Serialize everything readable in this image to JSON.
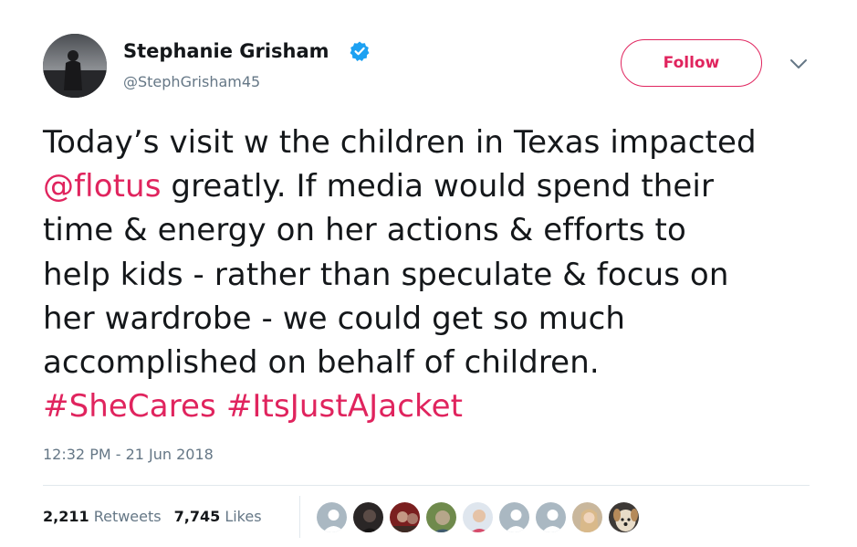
{
  "author": {
    "display_name": "Stephanie Grisham",
    "handle": "@StephGrisham45",
    "verified_icon": "verified-badge-icon",
    "avatar_icon": "profile-photo"
  },
  "follow_button": {
    "label": "Follow"
  },
  "menu": {
    "icon": "chevron-down-icon"
  },
  "tweet": {
    "line1": "Today’s visit w the children in Texas impacted",
    "mention": "@flotus",
    "line2_rest": " greatly. If media would spend their",
    "line3": "time & energy on her actions & efforts to",
    "line4": "help kids - rather than speculate & focus on",
    "line5": "her wardrobe - we could get so much",
    "line6": "accomplished on behalf of children.",
    "hashtag1": "#SheCares",
    "hashtag2": "#ItsJustAJacket"
  },
  "timestamp": "12:32 PM - 21 Jun 2018",
  "stats": {
    "retweets_count": "2,211",
    "retweets_label": "Retweets",
    "likes_count": "7,745",
    "likes_label": "Likes"
  },
  "colors": {
    "link": "#e0245e",
    "secondary_text": "#657786",
    "verified": "#1da1f2"
  },
  "liker_avatars": [
    "default-avatar-icon",
    "profile-photo",
    "profile-photo",
    "profile-photo",
    "profile-photo",
    "default-avatar-icon",
    "default-avatar-icon",
    "profile-photo",
    "profile-photo"
  ]
}
